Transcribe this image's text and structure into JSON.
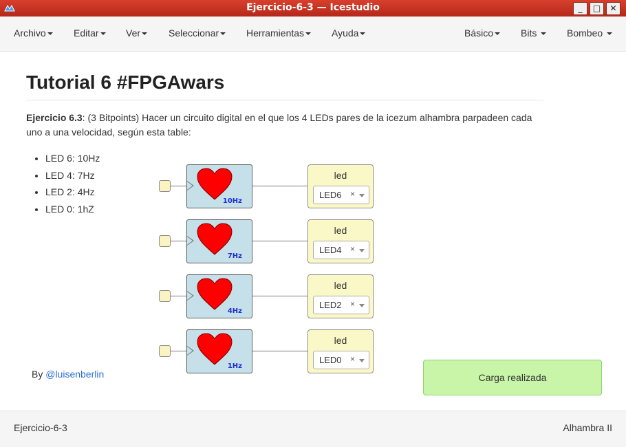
{
  "window": {
    "title": "Ejercicio-6-3 — Icestudio"
  },
  "menu": {
    "left": [
      "Archivo",
      "Editar",
      "Ver",
      "Seleccionar",
      "Herramientas",
      "Ayuda"
    ],
    "right": [
      "Básico",
      "Bits",
      "Bombeo"
    ]
  },
  "content": {
    "title": "Tutorial 6 #FPGAwars",
    "exercise_label": "Ejercicio 6.3",
    "exercise_text": ": (3 Bitpoints) Hacer un circuito digital en el que los 4 LEDs pares de la icezum alhambra parpadeen cada uno a una velocidad, según esta table:",
    "list": [
      "LED 6: 10Hz",
      "LED 4: 7Hz",
      "LED 2: 4Hz",
      "LED 0: 1hZ"
    ],
    "byline_prefix": "By ",
    "byline_link": "@luisenberlin"
  },
  "circuit": {
    "heart_color": "#ff0000",
    "rows": [
      {
        "freq": "10Hz",
        "led_label": "led",
        "led_value": "LED6",
        "clear": "×"
      },
      {
        "freq": "7Hz",
        "led_label": "led",
        "led_value": "LED4",
        "clear": "×"
      },
      {
        "freq": "4Hz",
        "led_label": "led",
        "led_value": "LED2",
        "clear": "×"
      },
      {
        "freq": "1Hz",
        "led_label": "led",
        "led_value": "LED0",
        "clear": "×"
      }
    ]
  },
  "toast": {
    "message": "Carga realizada",
    "color": "#c9f5a8"
  },
  "status": {
    "project": "Ejercicio-6-3",
    "board": "Alhambra II"
  },
  "colors": {
    "titlebar": "#c8321f",
    "block_blue": "#c6e0ea",
    "block_yellow": "#fbf8c7",
    "link": "#2a6fd6"
  }
}
